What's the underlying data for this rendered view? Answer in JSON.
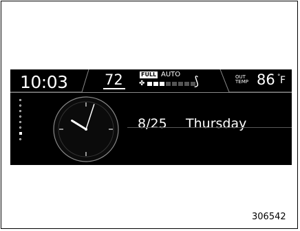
{
  "status_bar": {
    "time": "10:03",
    "set_temp": "72",
    "fan_mode_full": "FULL",
    "fan_mode_auto": "AUTO",
    "fan_level": 0.4,
    "out_label": "OUT TEMP",
    "out_temp": "86",
    "out_unit": "F",
    "out_degree": "°"
  },
  "main": {
    "date": "8/25",
    "day": "Thursday",
    "page_indicator_active": 7,
    "page_indicator_total": 8
  },
  "clock": {
    "hour": 10,
    "minute": 3
  },
  "figure_id": "306542",
  "icons": {
    "fan": "fan-icon",
    "mode": "airflow-mode-icon"
  },
  "colors": {
    "screen": "#000000",
    "text": "#ffffff",
    "dim": "#555555"
  }
}
